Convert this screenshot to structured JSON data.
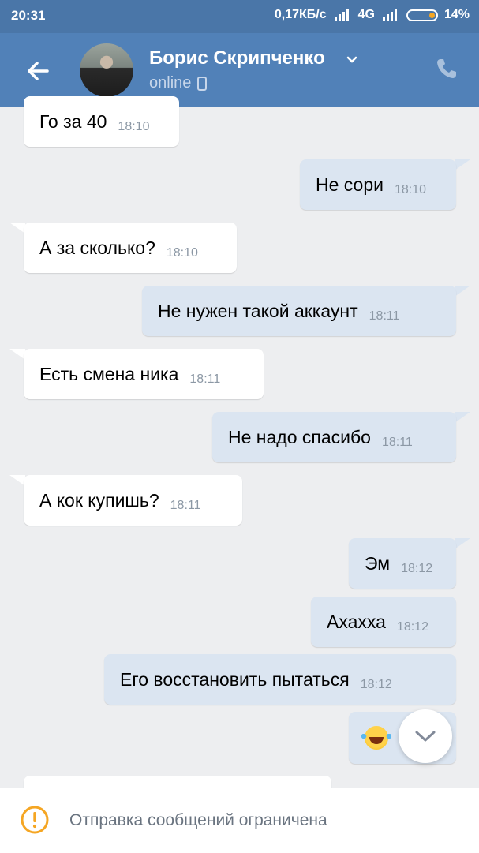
{
  "status_bar": {
    "time": "20:31",
    "net_speed": "0,17КБ/с",
    "network": "4G",
    "battery": "14%"
  },
  "header": {
    "contact_name": "Борис Скрипченко",
    "status": "online"
  },
  "messages": [
    {
      "dir": "in",
      "text": "Го за 40",
      "time": "18:10"
    },
    {
      "dir": "out",
      "text": "Не сори",
      "time": "18:10"
    },
    {
      "dir": "in",
      "text": "А за сколько?",
      "time": "18:10"
    },
    {
      "dir": "out",
      "text": "Не нужен такой аккаунт",
      "time": "18:11"
    },
    {
      "dir": "in",
      "text": "Есть смена ника",
      "time": "18:11"
    },
    {
      "dir": "out",
      "text": "Не надо спасибо",
      "time": "18:11"
    },
    {
      "dir": "in",
      "text": "А кок купишь?",
      "time": "18:11"
    },
    {
      "dir": "out",
      "text": "Эм",
      "time": "18:12"
    },
    {
      "dir": "out",
      "text": "Ахахха",
      "time": "18:12"
    },
    {
      "dir": "out",
      "text": "Его восстановить пытаться",
      "time": "18:12"
    },
    {
      "dir": "out",
      "emoji": "face-with-tears-of-joy"
    }
  ],
  "bottom_bar": {
    "notice": "Отправка сообщений ограничена"
  },
  "colors": {
    "header": "#5181b8",
    "status_bar": "#4a76a8",
    "background": "#edeef0",
    "outgoing_bubble": "#dbe5f1",
    "incoming_bubble": "#ffffff",
    "warning": "#f5a623"
  }
}
